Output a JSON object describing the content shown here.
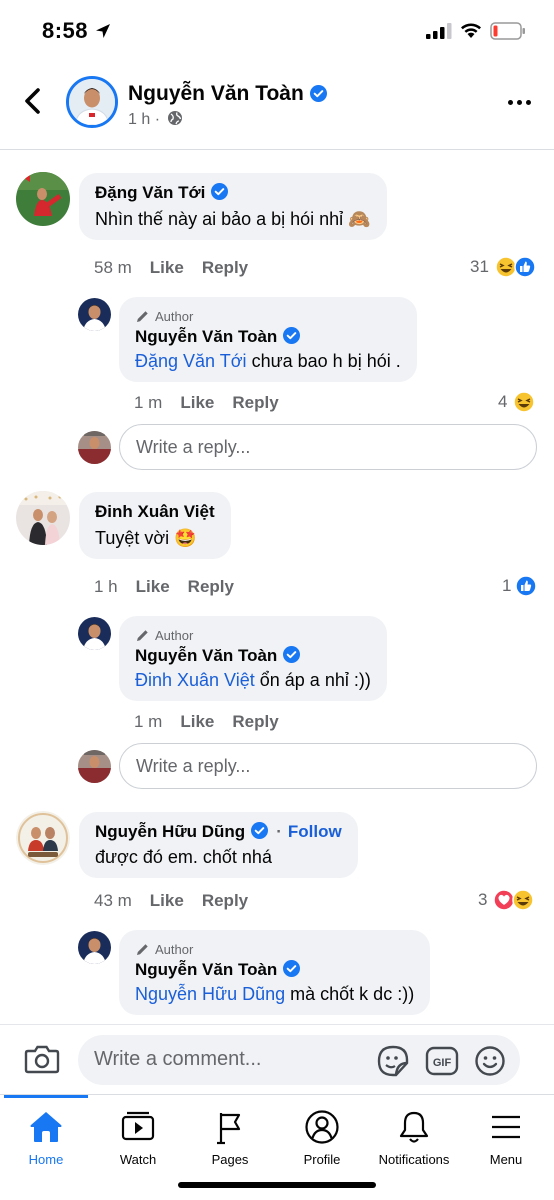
{
  "status_bar": {
    "time": "8:58"
  },
  "header": {
    "name": "Nguyễn Văn Toàn",
    "subtitle": "1 h ·",
    "icons": {
      "back": "chevron-left-icon",
      "globe": "globe-icon",
      "more": "more-horizontal-icon",
      "verified": "verified-badge-icon"
    }
  },
  "comments": [
    {
      "author": "Đặng Văn Tới",
      "verified": true,
      "text": "Nhìn thế này ai bảo a bị hói nhỉ 🙈",
      "time": "58 m",
      "like_label": "Like",
      "reply_label": "Reply",
      "reaction_count": "31",
      "reactions": [
        "haha",
        "like"
      ],
      "replies": [
        {
          "author_tag": "Author",
          "author": "Nguyễn Văn Toàn",
          "verified": true,
          "mention": "Đặng Văn Tới",
          "text": "chưa bao h bị hói .",
          "time": "1 m",
          "like_label": "Like",
          "reply_label": "Reply",
          "reaction_count": "4",
          "reactions": [
            "haha"
          ]
        }
      ],
      "reply_placeholder": "Write a reply..."
    },
    {
      "author": "Đinh Xuân Việt",
      "verified": false,
      "text": "Tuyệt vời 🤩",
      "time": "1 h",
      "like_label": "Like",
      "reply_label": "Reply",
      "reaction_count": "1",
      "reactions": [
        "like"
      ],
      "replies": [
        {
          "author_tag": "Author",
          "author": "Nguyễn Văn Toàn",
          "verified": true,
          "mention": "Đinh Xuân Việt",
          "text": " ổn áp a nhỉ :))",
          "time": "1 m",
          "like_label": "Like",
          "reply_label": "Reply"
        }
      ],
      "reply_placeholder": "Write a reply..."
    },
    {
      "author": "Nguyễn Hữu Dũng",
      "verified": true,
      "follow_label": "Follow",
      "text": "được đó em. chốt nhá",
      "time": "43 m",
      "like_label": "Like",
      "reply_label": "Reply",
      "reaction_count": "3",
      "reactions": [
        "love",
        "haha"
      ],
      "replies": [
        {
          "author_tag": "Author",
          "author": "Nguyễn Văn Toàn",
          "verified": true,
          "mention": "Nguyễn Hữu Dũng",
          "text": "mà chốt k dc :))"
        }
      ]
    }
  ],
  "composer": {
    "placeholder": "Write a comment...",
    "icons": [
      "camera-icon",
      "sticker-icon",
      "gif-icon",
      "emoji-icon"
    ]
  },
  "tabs": [
    {
      "label": "Home",
      "icon": "home-icon",
      "active": true
    },
    {
      "label": "Watch",
      "icon": "watch-icon",
      "active": false
    },
    {
      "label": "Pages",
      "icon": "flag-icon",
      "active": false
    },
    {
      "label": "Profile",
      "icon": "profile-icon",
      "active": false
    },
    {
      "label": "Notifications",
      "icon": "bell-icon",
      "active": false
    },
    {
      "label": "Menu",
      "icon": "menu-icon",
      "active": false
    }
  ],
  "colors": {
    "accent": "#1877f2",
    "mention": "#1a5fd8",
    "bubble": "#f0f2f5",
    "secondary_text": "#65676b"
  }
}
